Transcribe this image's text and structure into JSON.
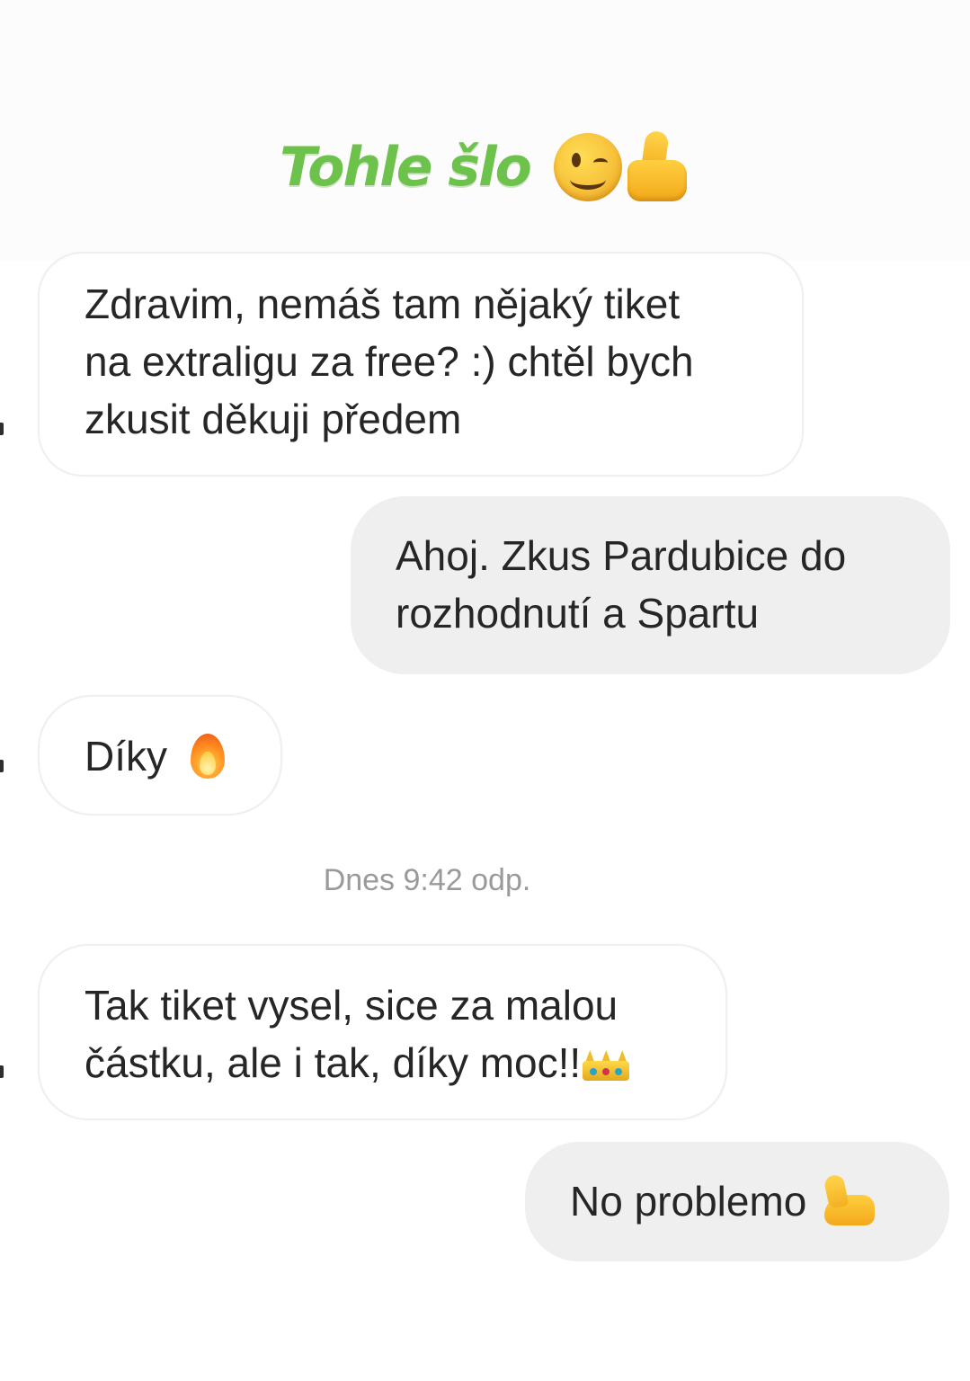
{
  "header": {
    "title": "Tohle šlo",
    "title_color": "#6cc24a",
    "emojis": [
      "winking-face-icon",
      "thumbs-up-icon"
    ]
  },
  "messages": [
    {
      "direction": "incoming",
      "text": "Zdravim, nemáš tam nějaký tiket\nna extraligu za free? :) chtěl bych\nzkusit děkuji předem"
    },
    {
      "direction": "outgoing",
      "text": "Ahoj. Zkus Pardubice do\nrozhodnutí a Spartu"
    },
    {
      "direction": "incoming",
      "text": "Díky",
      "emoji": "fire-icon"
    },
    {
      "direction": "incoming",
      "text": "Tak tiket vysel, sice za malou\nčástku, ale i tak, díky moc!!",
      "emoji": "crown-icon"
    },
    {
      "direction": "outgoing",
      "text": "No problemo",
      "emoji": "flexed-biceps-icon"
    }
  ],
  "timestamp": "Dnes 9:42 odp.",
  "colors": {
    "incoming_bubble": "#ffffff",
    "outgoing_bubble": "#efefef",
    "text": "#262626",
    "timestamp": "#9a9a9a"
  }
}
